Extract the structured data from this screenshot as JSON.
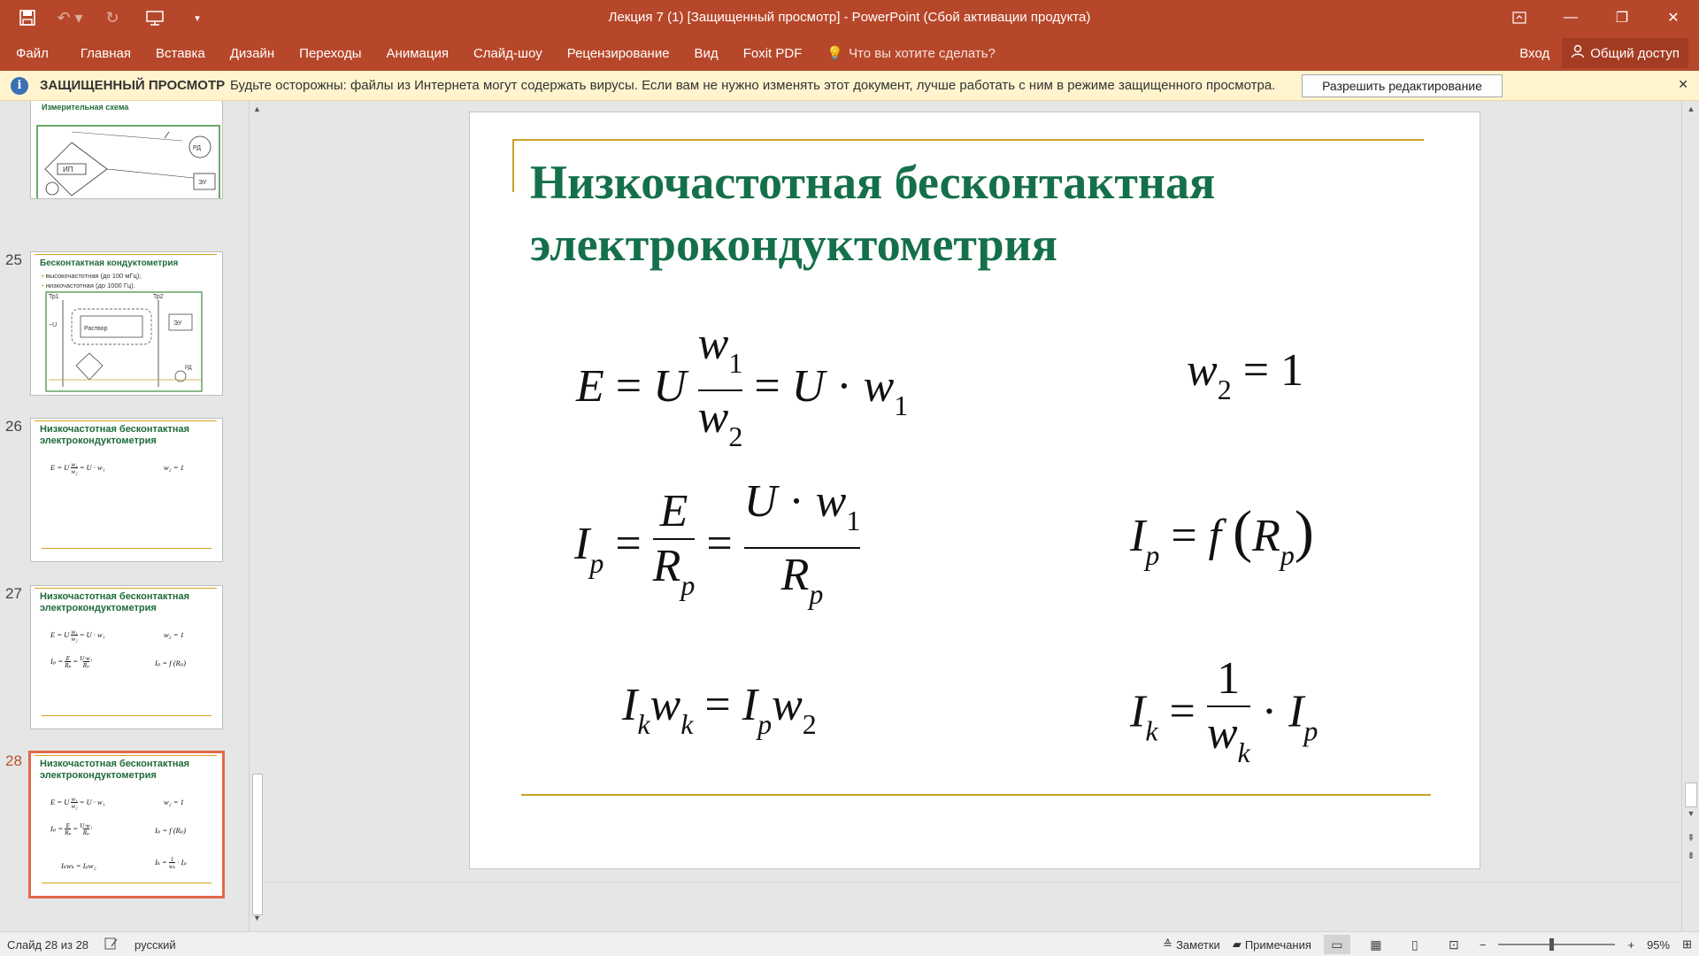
{
  "titlebar": {
    "title": "Лекция 7 (1) [Защищенный просмотр] - PowerPoint (Сбой активации продукта)",
    "save_icon": "save-icon",
    "undo_icon": "undo-icon",
    "redo_icon": "redo-icon",
    "present_icon": "present-from-start-icon",
    "customize_icon": "customize-qat-icon"
  },
  "menu": {
    "tabs": [
      "Файл",
      "Главная",
      "Вставка",
      "Дизайн",
      "Переходы",
      "Анимация",
      "Слайд-шоу",
      "Рецензирование",
      "Вид",
      "Foxit PDF"
    ],
    "tell_me": "Что вы хотите сделать?",
    "signin": "Вход",
    "share": "Общий доступ"
  },
  "infobar": {
    "label": "ЗАЩИЩЕННЫЙ ПРОСМОТР",
    "message": "Будьте осторожны: файлы из Интернета могут содержать вирусы. Если вам не нужно изменять этот документ, лучше работать с ним в режиме защищенного просмотра.",
    "enable_button": "Разрешить редактирование"
  },
  "thumbnails": [
    {
      "num": "",
      "title": "Измерительная схема"
    },
    {
      "num": "25",
      "title": "Бесконтактная кондуктометрия",
      "bullets": [
        "высокочастотная (до 100 мГц);",
        "низкочастотная (до 1000 Гц)."
      ]
    },
    {
      "num": "26",
      "title": "Низкочастотная бесконтактная электрокондуктометрия"
    },
    {
      "num": "27",
      "title": "Низкочастотная бесконтактная электрокондуктометрия"
    },
    {
      "num": "28",
      "title": "Низкочастотная бесконтактная электрокондуктометрия"
    }
  ],
  "slide": {
    "title_line1": "Низкочастотная бесконтактная",
    "title_line2": "электрокондуктометрия"
  },
  "status": {
    "slide_info": "Слайд 28 из 28",
    "language": "русский",
    "notes": "Заметки",
    "comments": "Примечания",
    "zoom": "95%"
  },
  "colors": {
    "ribbon": "#b7472a",
    "slide_title": "#14704a",
    "accent_line": "#c9a227",
    "active_thumb_border": "#e1694b"
  }
}
